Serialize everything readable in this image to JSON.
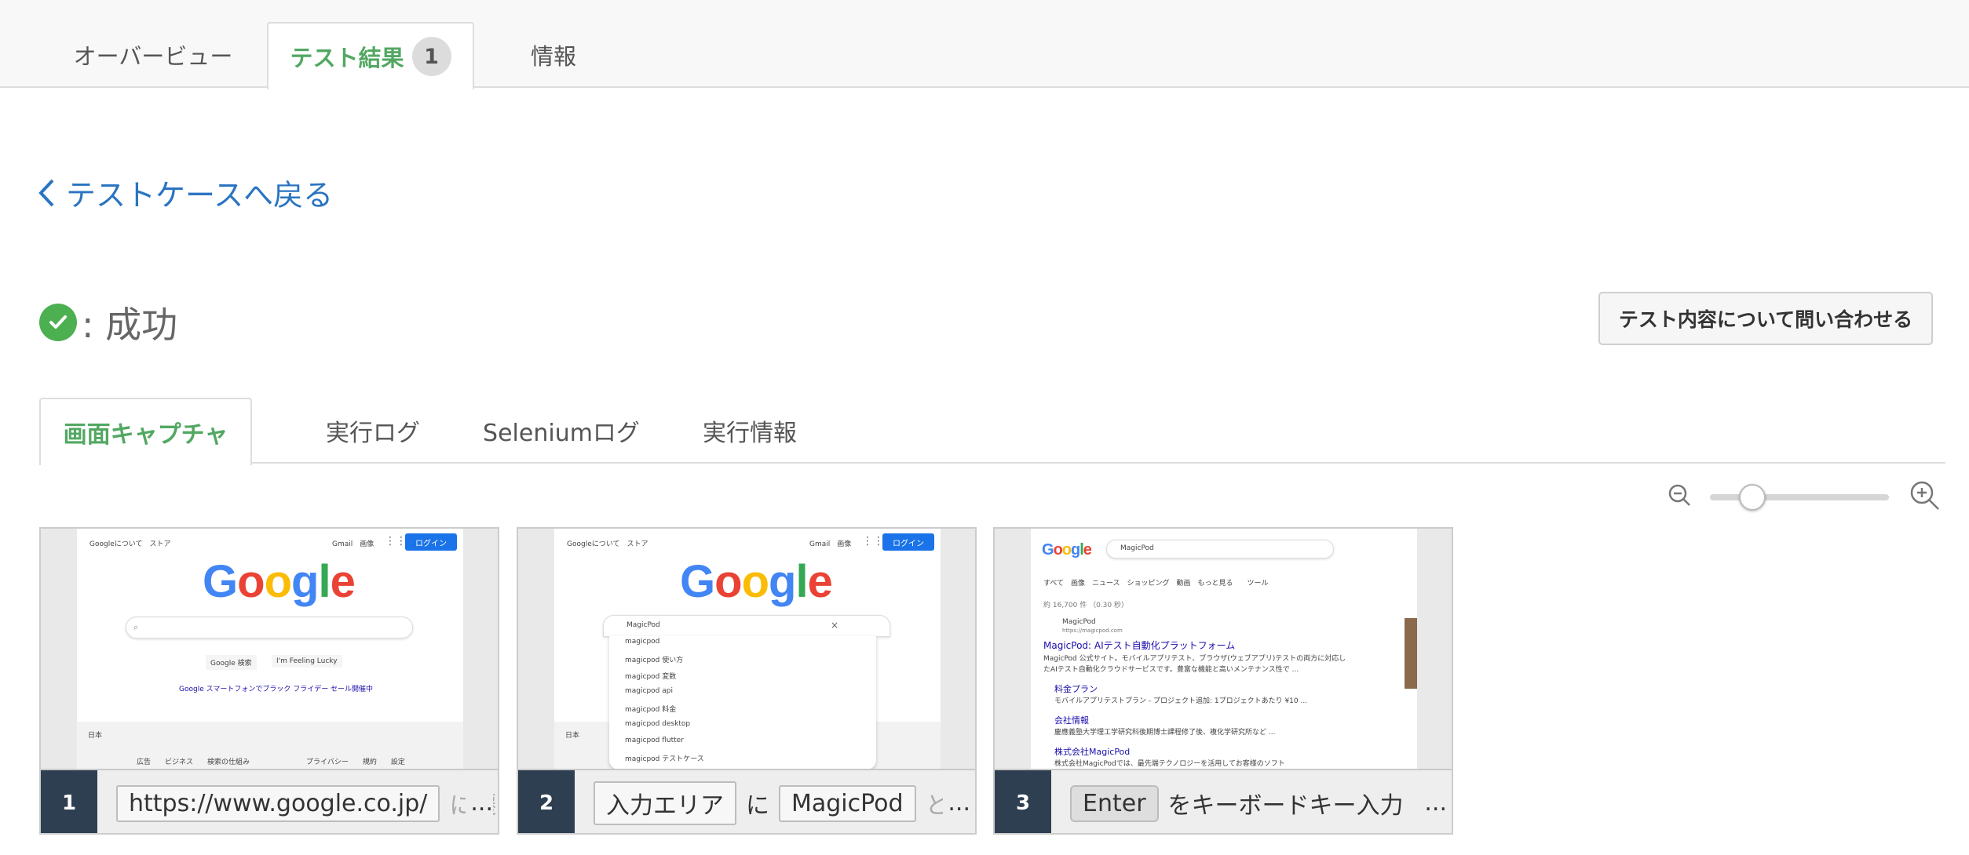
{
  "top_tabs": [
    {
      "label": "オーバービュー"
    },
    {
      "label": "テスト結果",
      "badge": "1"
    },
    {
      "label": "情報"
    }
  ],
  "back_link": "テストケースへ戻る",
  "status": {
    "label": ": 成功",
    "color": "#4caf50"
  },
  "inquiry_button": "テスト内容について問い合わせる",
  "sub_tabs": [
    {
      "label": "画面キャプチャ"
    },
    {
      "label": "実行ログ"
    },
    {
      "label": "Seleniumログ"
    },
    {
      "label": "実行情報"
    }
  ],
  "zoom": {
    "level": 0.25,
    "out_icon": "zoom-out-icon",
    "in_icon": "zoom-in-icon"
  },
  "captures": [
    {
      "number": "1",
      "chip1": "https://www.google.co.jp/",
      "text1": "に遷",
      "more": "...",
      "shot": {
        "top_left": "Googleについて　ストア",
        "top_right": "Gmail　画像",
        "login": "ログイン",
        "btn1": "Google 検索",
        "btn2": "I'm Feeling Lucky",
        "promo": "Google スマートフォンでブラック フライデー セール開催中",
        "footer_country": "日本",
        "footer_links": "広告　　ビジネス　　検索の仕組み",
        "footer_links2": "プライバシー　　規約　　設定"
      }
    },
    {
      "number": "2",
      "chip1": "入力エリア",
      "text1": "に",
      "chip2": "MagicPod",
      "text2": "と",
      "more": "...",
      "shot": {
        "top_left": "Googleについて　ストア",
        "top_right": "Gmail　画像",
        "login": "ログイン",
        "query": "MagicPod",
        "suggestions": [
          "magicpod",
          "magicpod 使い方",
          "magicpod 変数",
          "magicpod api",
          "magicpod 料金",
          "magicpod desktop",
          "magicpod flutter",
          "magicpod テストケース"
        ],
        "footer_country": "日本"
      }
    },
    {
      "number": "3",
      "chip1": "Enter",
      "text1": "をキーボードキー入力",
      "more": "...",
      "shot": {
        "query": "MagicPod",
        "tabs": "すべて　画像　ニュース　ショッピング　動画　もっと見る　　ツール",
        "count": "約 16,700 件 （0.30 秒）",
        "site_name": "MagicPod",
        "site_url": "https://magicpod.com",
        "result_title": "MagicPod: AIテスト自動化プラットフォーム",
        "result_desc1": "MagicPod 公式サイト。モバイルアプリテスト、ブラウザ(ウェブアプリ)テストの両方に対応し",
        "result_desc2": "たAIテスト自動化クラウドサービスです。豊富な機能と高いメンテナンス性で ...",
        "sub1_title": "料金プラン",
        "sub1_desc": "モバイルアプリテストプラン - プロジェクト追加: 1プロジェクトあたり ¥10 ...",
        "sub2_title": "会社情報",
        "sub2_desc": "慶應義塾大学理工学研究科後期博士課程修了後、複化学研究所など ...",
        "sub3_title": "株式会社MagicPod",
        "sub3_desc": "株式会社MagicPodでは、最先端テクノロジーを活用してお客様のソフト"
      }
    }
  ]
}
